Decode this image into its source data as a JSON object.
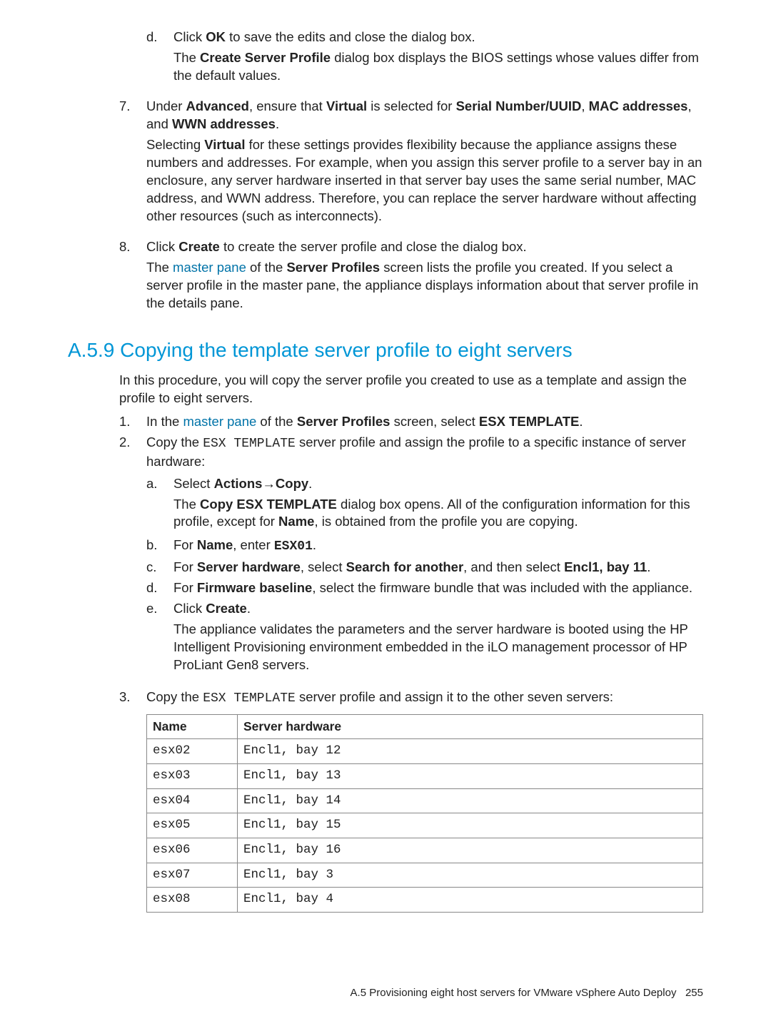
{
  "continuation": {
    "item_d": {
      "label": "d.",
      "line1_pre": "Click ",
      "bold1": "OK",
      "line1_post": " to save the edits and close the dialog box.",
      "para_pre": "The ",
      "para_bold": "Create Server Profile",
      "para_post": " dialog box displays the BIOS settings whose values differ from the default values."
    },
    "item_7": {
      "label": "7.",
      "t1": "Under ",
      "adv": "Advanced",
      "t2": ", ensure that ",
      "virt": "Virtual",
      "t3": " is selected for ",
      "sn": "Serial Number/UUID",
      "t4": ", ",
      "mac": "MAC addresses",
      "t5": ", and ",
      "wwn": "WWN addresses",
      "t6": ".",
      "p2_pre": "Selecting ",
      "p2_b": "Virtual",
      "p2_post": " for these settings provides flexibility because the appliance assigns these numbers and addresses. For example, when you assign this server profile to a server bay in an enclosure, any server hardware inserted in that server bay uses the same serial number, MAC address, and WWN address. Therefore, you can replace the server hardware without affecting other resources (such as interconnects)."
    },
    "item_8": {
      "label": "8.",
      "t1": "Click ",
      "b1": "Create",
      "t2": " to create the server profile and close the dialog box.",
      "p2_pre": "The ",
      "p2_link": "master pane",
      "p2_mid": " of the ",
      "p2_b": "Server Profiles",
      "p2_post": " screen lists the profile you created. If you select a server profile in the master pane, the appliance displays information about that server profile in the details pane."
    }
  },
  "section": {
    "heading": "A.5.9 Copying the template server profile to eight servers",
    "intro": "In this procedure, you will copy the server profile you created to use as a template and assign the profile to eight servers.",
    "step1": {
      "label": "1.",
      "t1": "In the ",
      "link": "master pane",
      "t2": " of the ",
      "b1": "Server Profiles",
      "t3": " screen, select ",
      "b2": "ESX TEMPLATE",
      "t4": "."
    },
    "step2": {
      "label": "2.",
      "t1": "Copy the ",
      "m1": "ESX TEMPLATE",
      "t2": " server profile and assign the profile to a specific instance of server hardware:",
      "a": {
        "label": "a.",
        "t1": "Select ",
        "b1": "Actions",
        "arrow": "→",
        "b2": "Copy",
        "t2": ".",
        "p_pre": "The ",
        "p_b": "Copy ESX TEMPLATE",
        "p_mid": " dialog box opens. All of the configuration information for this profile, except for ",
        "p_b2": "Name",
        "p_post": ", is obtained from the profile you are copying."
      },
      "b": {
        "label": "b.",
        "t1": "For ",
        "b1": "Name",
        "t2": ", enter ",
        "m1": "ESX01",
        "t3": "."
      },
      "c": {
        "label": "c.",
        "t1": "For ",
        "b1": "Server hardware",
        "t2": ", select ",
        "b2": "Search for another",
        "t3": ", and then select ",
        "b3": "Encl1, bay 11",
        "t4": "."
      },
      "d": {
        "label": "d.",
        "t1": "For ",
        "b1": "Firmware baseline",
        "t2": ", select the firmware bundle that was included with the appliance."
      },
      "e": {
        "label": "e.",
        "t1": "Click ",
        "b1": "Create",
        "t2": ".",
        "p": "The appliance validates the parameters and the server hardware is booted using the HP Intelligent Provisioning environment embedded in the iLO management processor of HP ProLiant Gen8 servers."
      }
    },
    "step3": {
      "label": "3.",
      "t1": "Copy the ",
      "m1": "ESX TEMPLATE",
      "t2": " server profile and assign it to the other seven servers:"
    },
    "table": {
      "headers": {
        "name": "Name",
        "hw": "Server hardware"
      },
      "rows": [
        {
          "name": "esx02",
          "hw": "Encl1, bay 12"
        },
        {
          "name": "esx03",
          "hw": "Encl1, bay 13"
        },
        {
          "name": "esx04",
          "hw": "Encl1, bay 14"
        },
        {
          "name": "esx05",
          "hw": "Encl1, bay 15"
        },
        {
          "name": "esx06",
          "hw": "Encl1, bay 16"
        },
        {
          "name": "esx07",
          "hw": "Encl1, bay 3"
        },
        {
          "name": "esx08",
          "hw": "Encl1, bay 4"
        }
      ]
    }
  },
  "footer": {
    "text": "A.5 Provisioning eight host servers for VMware vSphere Auto Deploy",
    "page": "255"
  }
}
